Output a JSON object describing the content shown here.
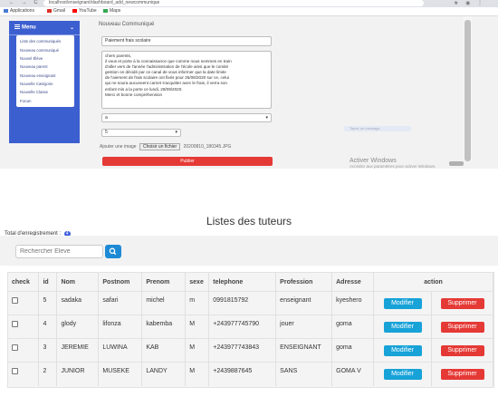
{
  "browser": {
    "url": "localhost/enseignant/dashboard_add_newcommunique",
    "nav_glyphs": "← → C",
    "ext_glyphs": "★ ◉ ⋮",
    "bookmarks": [
      {
        "label": "Applications",
        "color": "#4a7bd4"
      },
      {
        "label": "Gmail",
        "color": "#d93025"
      },
      {
        "label": "YouTube",
        "color": "#ff0000"
      },
      {
        "label": "Maps",
        "color": "#34a853"
      }
    ]
  },
  "sidebar": {
    "title": "Menu",
    "chevron": "⌄",
    "items": [
      "Liste des communiqués",
      "Nouveau communiqué",
      "Nouvel Élève",
      "Nouveau parent",
      "Nouveau enseignant",
      "Nouvelle Catégorie",
      "Nouvelle Classe",
      "Forum"
    ]
  },
  "form": {
    "title": "Nouveau Communiqué",
    "subject": "Paiement frais scolaire",
    "body": "chers parents,\nil vous et porte à la connaissance que comme nous sommes en train\nd'aller vers de l'année l'administration de l'école ainsi que le comité\ngestion on décidé par ce canal de vous informer que la date limite\nde l'aiement de frais scolaire ont fixés pour 25/08/2020 sur ce, celui\nqui ne soura aucuneent carnet s'acquitter avec le frais, il verra son\nenfant mis a la porte ce lundi, 28/09/2020.\nMerci et bonne compréhension",
    "select_a": "a",
    "select_5": "5",
    "caret": "▾",
    "image_label": "Ajouter une image",
    "file_button": "Choisir un fichier",
    "file_name": "20200810_180345.JPG",
    "publish_label": "Publier",
    "tooltip": "Tapez un message",
    "activate_title": "Activer Windows",
    "activate_sub": "Accédez aux paramètres pour activer Windows."
  },
  "page": {
    "title": "Listes des tuteurs",
    "total_label": "Total d'enregistrement :",
    "total_count": "4",
    "search_placeholder": "Rechercher Eleve"
  },
  "table": {
    "headers": [
      "check",
      "id",
      "Nom",
      "Postnom",
      "Prenom",
      "sexe",
      "telephone",
      "Profession",
      "Adresse",
      "action"
    ],
    "rows": [
      {
        "id": "5",
        "nom": "sadaka",
        "postnom": "safari",
        "prenom": "michel",
        "sexe": "m",
        "telephone": "0991815792",
        "profession": "enseignant",
        "adresse": "kyeshero"
      },
      {
        "id": "4",
        "nom": "glody",
        "postnom": "lifonza",
        "prenom": "kabemba",
        "sexe": "M",
        "telephone": "+243977745790",
        "profession": "jouer",
        "adresse": "goma"
      },
      {
        "id": "3",
        "nom": "JEREMIE",
        "postnom": "LUWINA",
        "prenom": "KAB",
        "sexe": "M",
        "telephone": "+243977743843",
        "profession": "ENSEIGNANT",
        "adresse": "goma"
      },
      {
        "id": "2",
        "nom": "JUNIOR",
        "postnom": "MUSEKE",
        "prenom": "LANDY",
        "sexe": "M",
        "telephone": "+2439887645",
        "profession": "SANS",
        "adresse": "GOMA V"
      }
    ],
    "modify_label": "Modifier",
    "delete_label": "Supprimer"
  },
  "colors": {
    "sidebar": "#3c5fd0",
    "publish": "#e53935",
    "modify": "#17a2d8",
    "delete": "#e53935",
    "search_button": "#1e8ad6"
  },
  "icons": [
    "hamburger-menu-icon",
    "search-icon",
    "checkbox"
  ]
}
